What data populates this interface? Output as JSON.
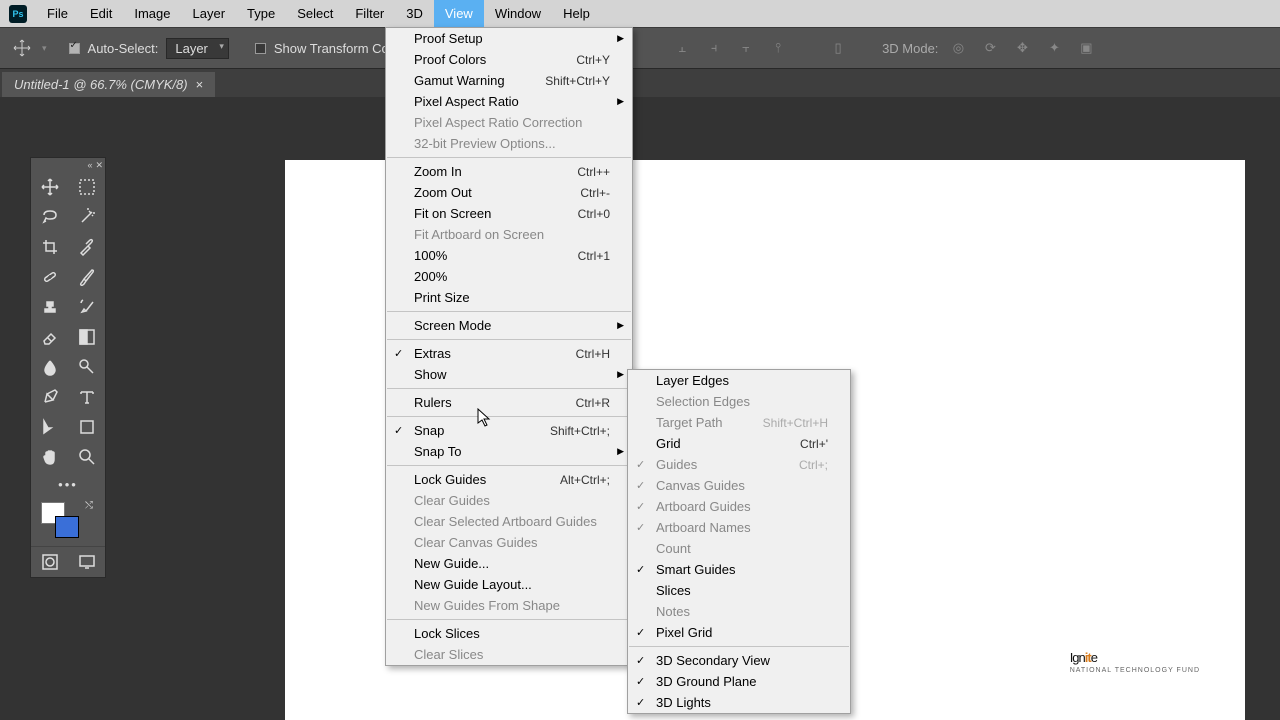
{
  "menubar": [
    "File",
    "Edit",
    "Image",
    "Layer",
    "Type",
    "Select",
    "Filter",
    "3D",
    "View",
    "Window",
    "Help"
  ],
  "menubar_active": "View",
  "options": {
    "auto_select_label": "Auto-Select:",
    "auto_select_value": "Layer",
    "show_transform_label": "Show Transform Control",
    "mode_label": "3D Mode:"
  },
  "tab": {
    "title": "Untitled-1 @ 66.7% (CMYK/8)",
    "close": "×"
  },
  "view_menu": [
    {
      "label": "Proof Setup",
      "sub": true
    },
    {
      "label": "Proof Colors",
      "shortcut": "Ctrl+Y"
    },
    {
      "label": "Gamut Warning",
      "shortcut": "Shift+Ctrl+Y"
    },
    {
      "label": "Pixel Aspect Ratio",
      "sub": true
    },
    {
      "label": "Pixel Aspect Ratio Correction",
      "disabled": true
    },
    {
      "label": "32-bit Preview Options...",
      "disabled": true
    },
    {
      "sep": true
    },
    {
      "label": "Zoom In",
      "shortcut": "Ctrl++"
    },
    {
      "label": "Zoom Out",
      "shortcut": "Ctrl+-"
    },
    {
      "label": "Fit on Screen",
      "shortcut": "Ctrl+0"
    },
    {
      "label": "Fit Artboard on Screen",
      "disabled": true
    },
    {
      "label": "100%",
      "shortcut": "Ctrl+1"
    },
    {
      "label": "200%"
    },
    {
      "label": "Print Size"
    },
    {
      "sep": true
    },
    {
      "label": "Screen Mode",
      "sub": true
    },
    {
      "sep": true
    },
    {
      "label": "Extras",
      "shortcut": "Ctrl+H",
      "check": true
    },
    {
      "label": "Show",
      "sub": true
    },
    {
      "sep": true
    },
    {
      "label": "Rulers",
      "shortcut": "Ctrl+R"
    },
    {
      "sep": true
    },
    {
      "label": "Snap",
      "shortcut": "Shift+Ctrl+;",
      "check": true
    },
    {
      "label": "Snap To",
      "sub": true
    },
    {
      "sep": true
    },
    {
      "label": "Lock Guides",
      "shortcut": "Alt+Ctrl+;"
    },
    {
      "label": "Clear Guides",
      "disabled": true
    },
    {
      "label": "Clear Selected Artboard Guides",
      "disabled": true
    },
    {
      "label": "Clear Canvas Guides",
      "disabled": true
    },
    {
      "label": "New Guide..."
    },
    {
      "label": "New Guide Layout..."
    },
    {
      "label": "New Guides From Shape",
      "disabled": true
    },
    {
      "sep": true
    },
    {
      "label": "Lock Slices"
    },
    {
      "label": "Clear Slices",
      "disabled": true
    }
  ],
  "show_menu": [
    {
      "label": "Layer Edges"
    },
    {
      "label": "Selection Edges",
      "disabled": true
    },
    {
      "label": "Target Path",
      "shortcut": "Shift+Ctrl+H",
      "disabled": true
    },
    {
      "label": "Grid",
      "shortcut": "Ctrl+'"
    },
    {
      "label": "Guides",
      "shortcut": "Ctrl+;",
      "check": true,
      "disabled": true
    },
    {
      "label": "Canvas Guides",
      "check": true,
      "disabled": true
    },
    {
      "label": "Artboard Guides",
      "check": true,
      "disabled": true
    },
    {
      "label": "Artboard Names",
      "check": true,
      "disabled": true
    },
    {
      "label": "Count",
      "disabled": true
    },
    {
      "label": "Smart Guides",
      "check": true
    },
    {
      "label": "Slices"
    },
    {
      "label": "Notes",
      "disabled": true
    },
    {
      "label": "Pixel Grid",
      "check": true
    },
    {
      "sep": true
    },
    {
      "label": "3D Secondary View",
      "check": true
    },
    {
      "label": "3D Ground Plane",
      "check": true
    },
    {
      "label": "3D Lights",
      "check": true
    }
  ],
  "watermark": {
    "text_a": "Ign",
    "text_b": "it",
    "text_c": "e",
    "sub": "NATIONAL TECHNOLOGY FUND"
  }
}
